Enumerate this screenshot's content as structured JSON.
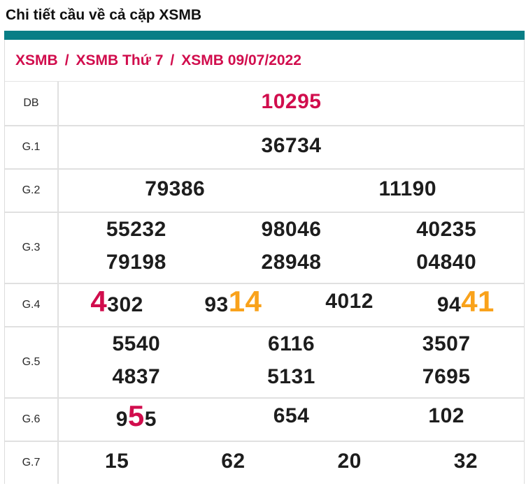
{
  "page_title": "Chi tiết cầu về cả cặp XSMB",
  "breadcrumb": {
    "items": [
      "XSMB",
      "XSMB Thứ 7",
      "XSMB 09/07/2022"
    ],
    "separator": "/"
  },
  "theme": {
    "accent_teal": "#087e86",
    "highlight_red": "#d10d4d",
    "highlight_orange": "#f9a21b",
    "number_black": "#1d1d1d",
    "border_gray": "#e3e3e3"
  },
  "table": {
    "rows": [
      {
        "label": "DB",
        "lines": [
          [
            [
              {
                "text": "10295",
                "color": "red"
              }
            ]
          ]
        ]
      },
      {
        "label": "G.1",
        "lines": [
          [
            [
              {
                "text": "36734"
              }
            ]
          ]
        ]
      },
      {
        "label": "G.2",
        "lines": [
          [
            [
              {
                "text": "79386"
              }
            ],
            [
              {
                "text": "11190"
              }
            ]
          ]
        ]
      },
      {
        "label": "G.3",
        "lines": [
          [
            [
              {
                "text": "55232"
              }
            ],
            [
              {
                "text": "98046"
              }
            ],
            [
              {
                "text": "40235"
              }
            ]
          ],
          [
            [
              {
                "text": "79198"
              }
            ],
            [
              {
                "text": "28948"
              }
            ],
            [
              {
                "text": "04840"
              }
            ]
          ]
        ]
      },
      {
        "label": "G.4",
        "lines": [
          [
            [
              {
                "text": "4",
                "color": "red",
                "big": true
              },
              {
                "text": "302"
              }
            ],
            [
              {
                "text": "93"
              },
              {
                "text": "14",
                "color": "orange",
                "big": true
              }
            ],
            [
              {
                "text": "4012"
              }
            ],
            [
              {
                "text": "94"
              },
              {
                "text": "41",
                "color": "orange",
                "big": true
              }
            ]
          ]
        ]
      },
      {
        "label": "G.5",
        "lines": [
          [
            [
              {
                "text": "5540"
              }
            ],
            [
              {
                "text": "6116"
              }
            ],
            [
              {
                "text": "3507"
              }
            ]
          ],
          [
            [
              {
                "text": "4837"
              }
            ],
            [
              {
                "text": "5131"
              }
            ],
            [
              {
                "text": "7695"
              }
            ]
          ]
        ]
      },
      {
        "label": "G.6",
        "lines": [
          [
            [
              {
                "text": "9"
              },
              {
                "text": "5",
                "color": "red",
                "big": true
              },
              {
                "text": "5"
              }
            ],
            [
              {
                "text": "654"
              }
            ],
            [
              {
                "text": "102"
              }
            ]
          ]
        ]
      },
      {
        "label": "G.7",
        "lines": [
          [
            [
              {
                "text": "15"
              }
            ],
            [
              {
                "text": "62"
              }
            ],
            [
              {
                "text": "20"
              }
            ],
            [
              {
                "text": "32"
              }
            ]
          ]
        ]
      }
    ]
  }
}
